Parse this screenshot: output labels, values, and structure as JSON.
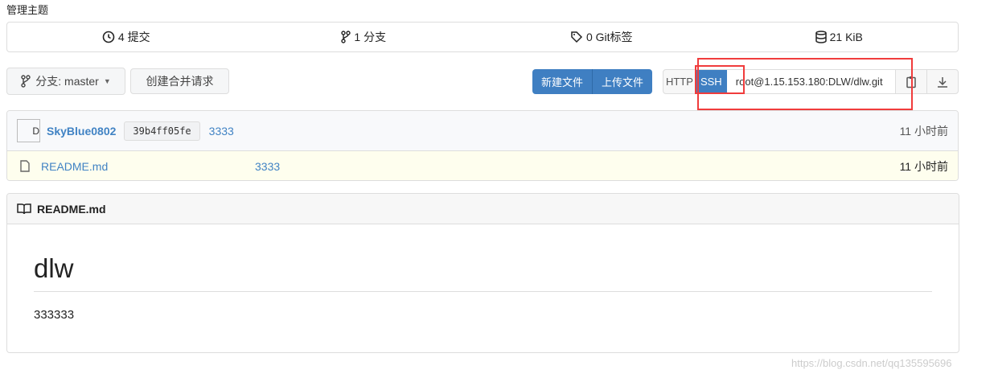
{
  "topic_label": "管理主题",
  "stats": {
    "commits": "4 提交",
    "branches": "1 分支",
    "tags": "0 Git标签",
    "size": "21 KiB"
  },
  "branch_button": "分支: master",
  "create_pr": "创建合并请求",
  "new_file": "新建文件",
  "upload_file": "上传文件",
  "clone": {
    "http": "HTTP",
    "ssh": "SSH",
    "url": "root@1.15.153.180:DLW/dlw.git"
  },
  "commit": {
    "avatar_alt": "D",
    "author": "SkyBlue0802",
    "sha": "39b4ff05fe",
    "message": "3333",
    "time": "11 小时前"
  },
  "files": [
    {
      "name": "README.md",
      "message": "3333",
      "time": "11 小时前"
    }
  ],
  "readme": {
    "title": "README.md",
    "heading": "dlw",
    "body": "333333"
  },
  "watermark": "https://blog.csdn.net/qq135595696",
  "colors": {
    "accent": "#3f7fc2",
    "highlight": "#f03c3c"
  }
}
